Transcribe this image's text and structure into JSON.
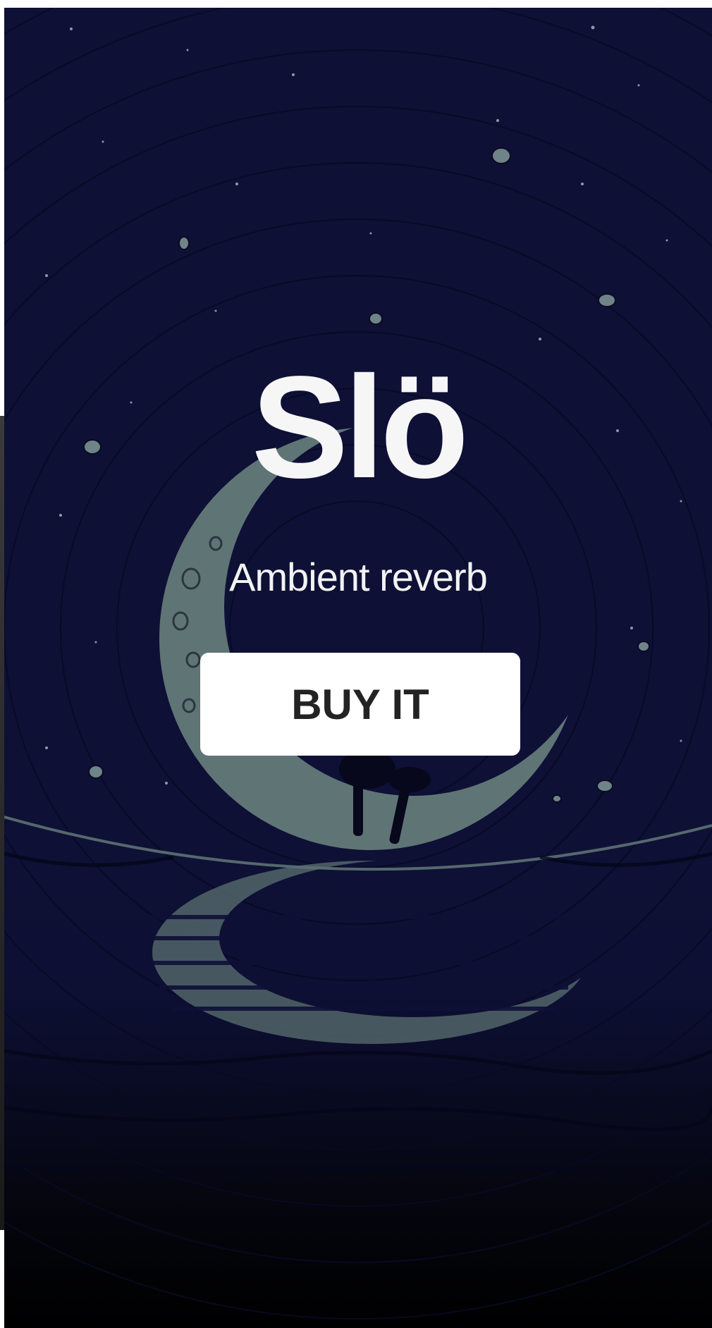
{
  "product": {
    "title": "Slö",
    "subtitle": "Ambient reverb",
    "cta_label": "BUY IT"
  },
  "colors": {
    "sky": "#0e1036",
    "moon": "#5f7575",
    "title": "#f6f6f6",
    "button_bg": "#ffffff",
    "button_text": "#232323"
  }
}
